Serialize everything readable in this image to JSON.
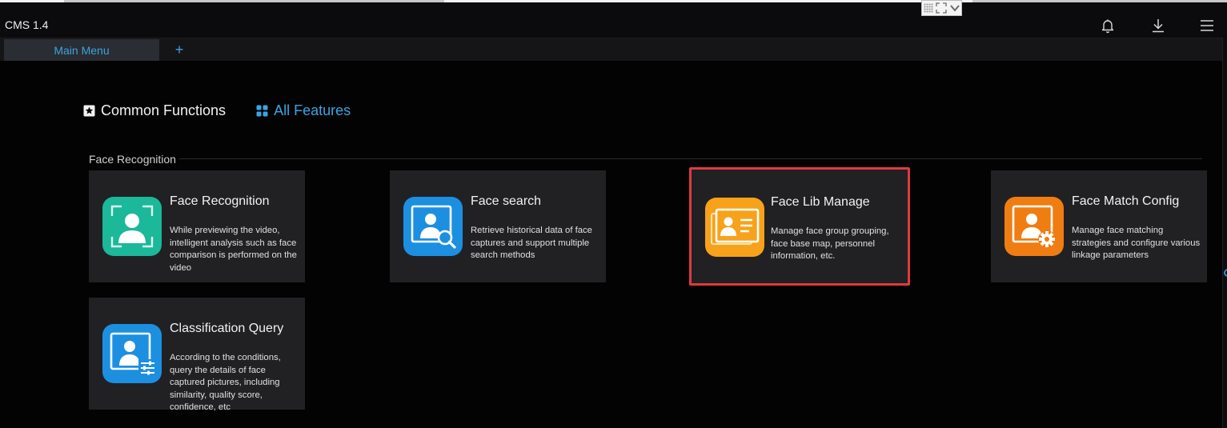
{
  "window": {
    "title": "CMS 1.4",
    "toolbar_icons": [
      "bell-icon",
      "download-icon",
      "menu-icon"
    ]
  },
  "tabs": {
    "main_label": "Main Menu",
    "add_label": "+"
  },
  "modes": {
    "common_label": "Common Functions",
    "all_label": "All Features",
    "active": "All Features"
  },
  "section": {
    "title": "Face Recognition"
  },
  "cards": [
    {
      "title": "Face Recognition",
      "description": "While previewing the video, intelligent analysis such as face comparison is performed on the video",
      "icon": "face-recognition-icon",
      "color": "#1bb89a"
    },
    {
      "title": "Face search",
      "description": "Retrieve historical data of face captures and support multiple search methods",
      "icon": "face-search-icon",
      "color": "#1d8fe0"
    },
    {
      "title": "Face Lib Manage",
      "description": "Manage face group grouping, face base map, personnel information, etc.",
      "icon": "face-lib-icon",
      "color": "#f7a21a",
      "selected": true
    },
    {
      "title": "Face Match Config",
      "description": "Manage face matching strategies and configure various linkage parameters",
      "icon": "face-match-config-icon",
      "color": "#f07d12"
    },
    {
      "title": "Classification Query",
      "description": "According to the conditions, query the details of face captured pictures, including similarity, quality score, confidence, etc",
      "icon": "classification-query-icon",
      "color": "#1d8fe0"
    }
  ],
  "colors": {
    "accent": "#3ba4e0",
    "selection": "#e0393e",
    "card_bg": "#212124"
  }
}
